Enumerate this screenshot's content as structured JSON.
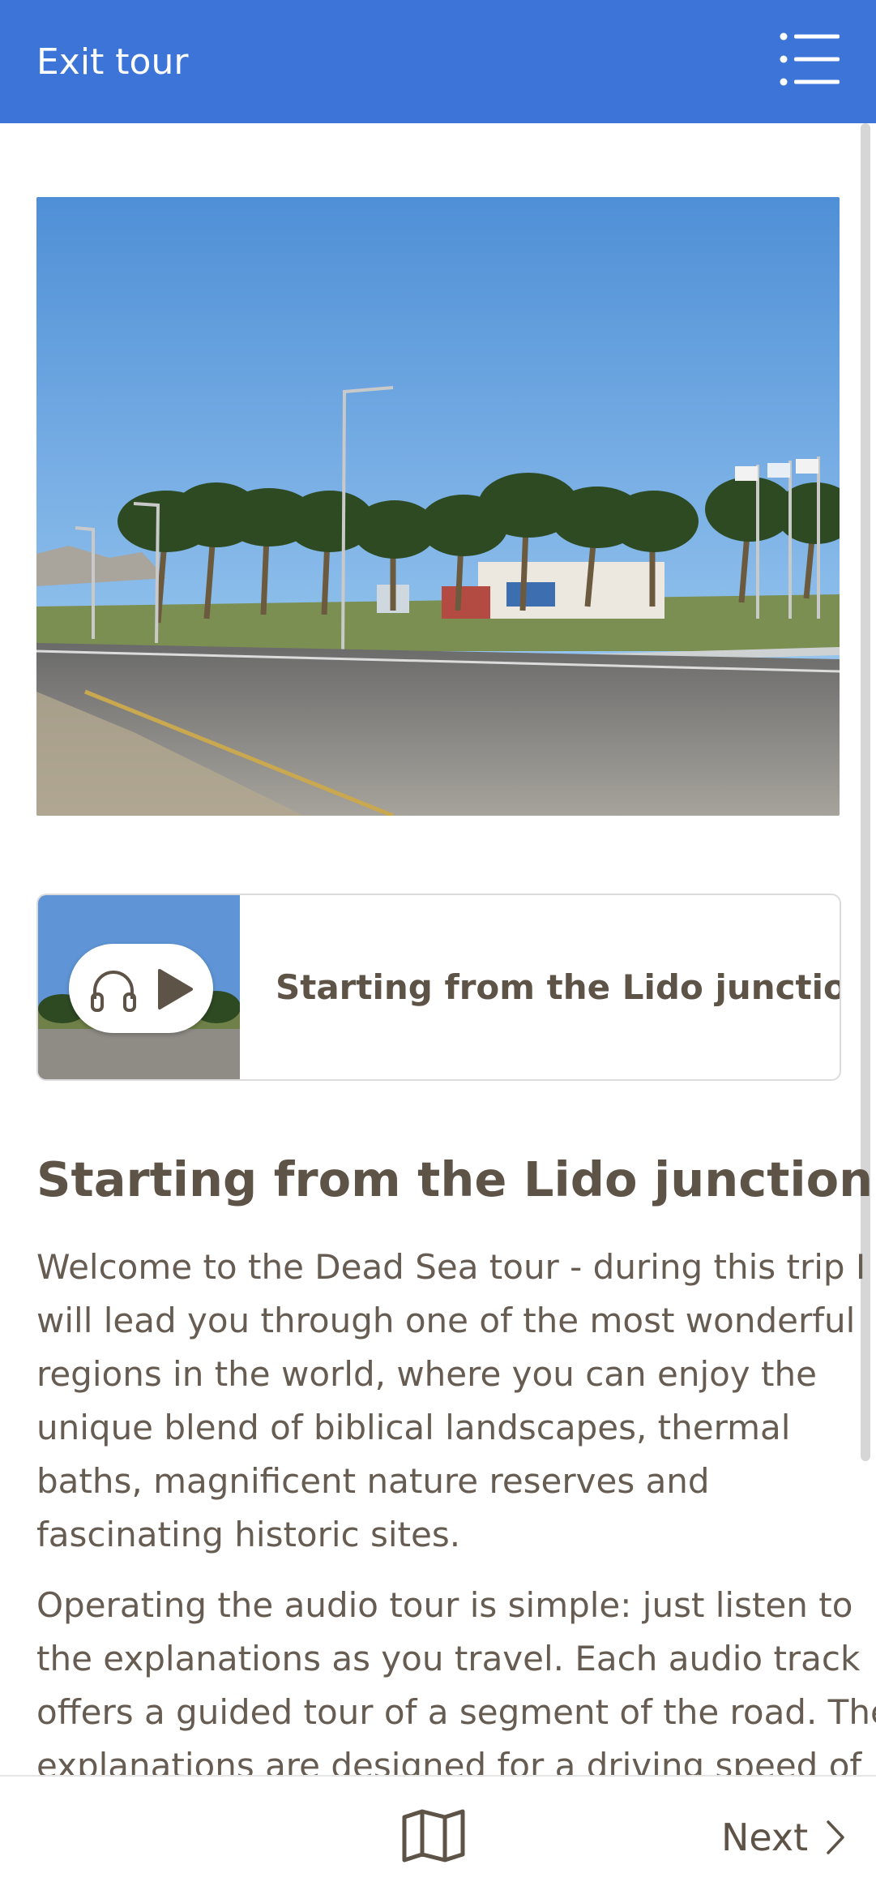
{
  "header": {
    "exit_label": "Exit tour",
    "menu_icon": "list-menu-icon",
    "background": "#3d74d8"
  },
  "hero": {
    "description_icon": "photo-palm-junction"
  },
  "audio_track": {
    "title": "Starting from the Lido junction",
    "icons": [
      "headphones-icon",
      "play-icon"
    ]
  },
  "article": {
    "title": "Starting from the Lido junction",
    "paragraph1_lines": [
      "Welcome to the Dead Sea tour - during this trip I",
      "will lead you through one of the most wonderful",
      "regions in the world, where you can enjoy the",
      "unique blend of biblical landscapes, thermal",
      "baths, magnificent nature reserves and",
      "fascinating historic sites."
    ],
    "paragraph2_lines": [
      "Operating the audio tour is simple: just listen to",
      "the explanations as you travel. Each audio track",
      "offers a guided tour of a segment of the road. The",
      "explanations are designed for a driving speed of"
    ]
  },
  "footer": {
    "map_icon": "map-icon",
    "next_label": "Next",
    "next_icon": "chevron-right-icon"
  },
  "colors": {
    "accent": "#3d74d8",
    "heading_text": "#5e5347",
    "body_text": "#665c52"
  }
}
